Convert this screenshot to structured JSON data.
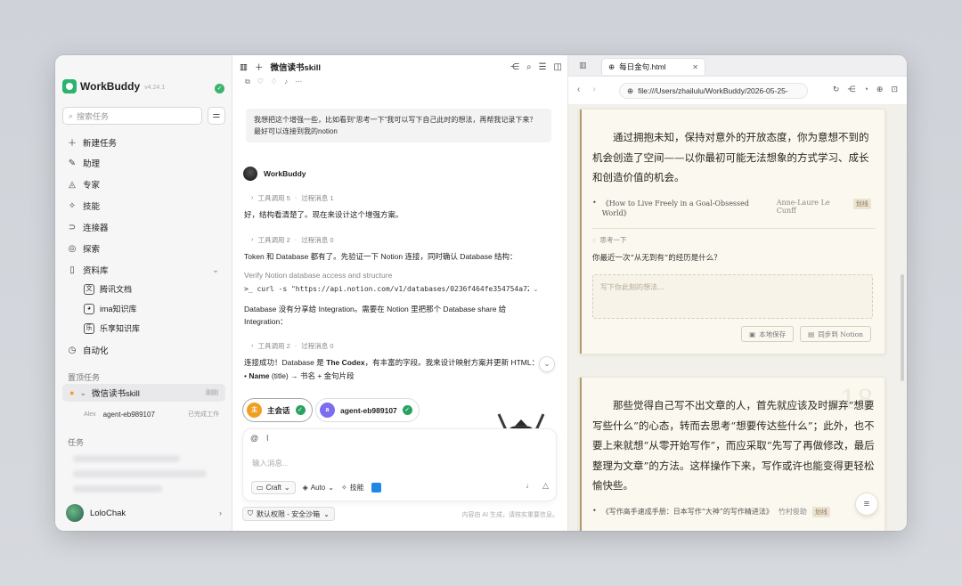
{
  "sidebar": {
    "brand": "WorkBuddy",
    "version": "v4.24.1",
    "search_placeholder": "搜索任务",
    "nav": [
      {
        "label": "新建任务",
        "icon": "plus-icon"
      },
      {
        "label": "助理",
        "icon": "wand-icon"
      },
      {
        "label": "专家",
        "icon": "graduation-cap-icon"
      },
      {
        "label": "技能",
        "icon": "magic-icon"
      },
      {
        "label": "连接器",
        "icon": "plug-icon"
      },
      {
        "label": "探索",
        "icon": "compass-icon"
      },
      {
        "label": "资料库",
        "icon": "book-icon"
      }
    ],
    "library": [
      {
        "label": "腾讯文档"
      },
      {
        "label": "ima知识库"
      },
      {
        "label": "乐享知识库"
      }
    ],
    "automation": "自动化",
    "pinned_section": "置顶任务",
    "pinned_task": {
      "name": "微信读书skill",
      "time": "刚刚"
    },
    "agent": {
      "owner": "Alex",
      "name": "agent-eb989107",
      "status": "已完成工作"
    },
    "tasks_section": "任务",
    "user": {
      "name": "LoloChak"
    }
  },
  "chat": {
    "title": "微信读书skill",
    "user_message": "我想把这个增强一些，比如看到“思考一下”我可以写下自己此时的想法，再帮我记录下来？最好可以连接到我的notion",
    "assistant_name": "WorkBuddy",
    "steps": [
      {
        "tool": "工具调用 5",
        "msg": "过程消息 1"
      },
      {
        "tool": "工具调用 2",
        "msg": "过程消息 0"
      },
      {
        "tool": "工具调用 2",
        "msg": "过程消息 0"
      }
    ],
    "p1": "好，结构看清楚了。现在来设计这个增强方案。",
    "p2": "Token 和 Database 都有了。先验证一下 Notion 连接，同时确认 Database 结构：",
    "verify_label": "Verify Notion database access and structure",
    "cmd": ">_ curl -s \"https://api.notion.com/v1/databases/0236f464fe354754a7271946…",
    "p3": "Database 没有分享给 Integration。需要在 Notion 里把那个 Database share 给 Integration：",
    "p4_a": "连接成功！Database 是 ",
    "p4_b": "The Codex",
    "p4_c": "，有丰富的字段。我来设计映射方案并更新 HTML：",
    "bullet_a": "Name",
    "bullet_b": " (title) → 书名 + 金句片段",
    "chips": [
      {
        "badge": "主",
        "label": "主会话",
        "color": "#f0a020"
      },
      {
        "badge": "a",
        "label": "agent-eb989107",
        "color": "#7b6cf0"
      }
    ],
    "input_placeholder": "输入消息...",
    "mode": "Craft",
    "model": "Auto",
    "skills": "技能",
    "permission": "默认权限 - 安全沙箱",
    "ai_note": "内容由 AI 生成，请核实重要信息。"
  },
  "browser": {
    "tab_title": "每日金句.html",
    "url": "file:///Users/zhailulu/WorkBuddy/2026-05-25-",
    "card1": {
      "quote": "通过拥抱未知，保持对意外的开放态度，你为意想不到的机会创造了空间——以你最初可能无法想象的方式学习、成长和创造价值的机会。",
      "book": "《How to Live Freely in a Goal-Obsessed World》",
      "author": "Anne-Laure Le Cunff",
      "tag": "划线",
      "think_label": "思考一下",
      "question": "你最近一次“从无到有”的经历是什么？",
      "placeholder": "写下你此刻的想法…",
      "save_local": "本地保存",
      "sync_notion": "同步到 Notion"
    },
    "card2": {
      "num": "18",
      "quote": "那些觉得自己写不出文章的人，首先就应该及时摒弃“想要写些什么”的心态，转而去思考“想要传达些什么”；此外，也不要上来就想“从零开始写作”，而应采取“先写了再做修改，最后整理为文章”的方法。这样操作下来，写作或许也能变得更轻松愉快些。",
      "book": "《写作高手速成手册：日本写作“大神”的写作精进法》",
      "author": "竹村俊助",
      "tag": "划线"
    }
  }
}
